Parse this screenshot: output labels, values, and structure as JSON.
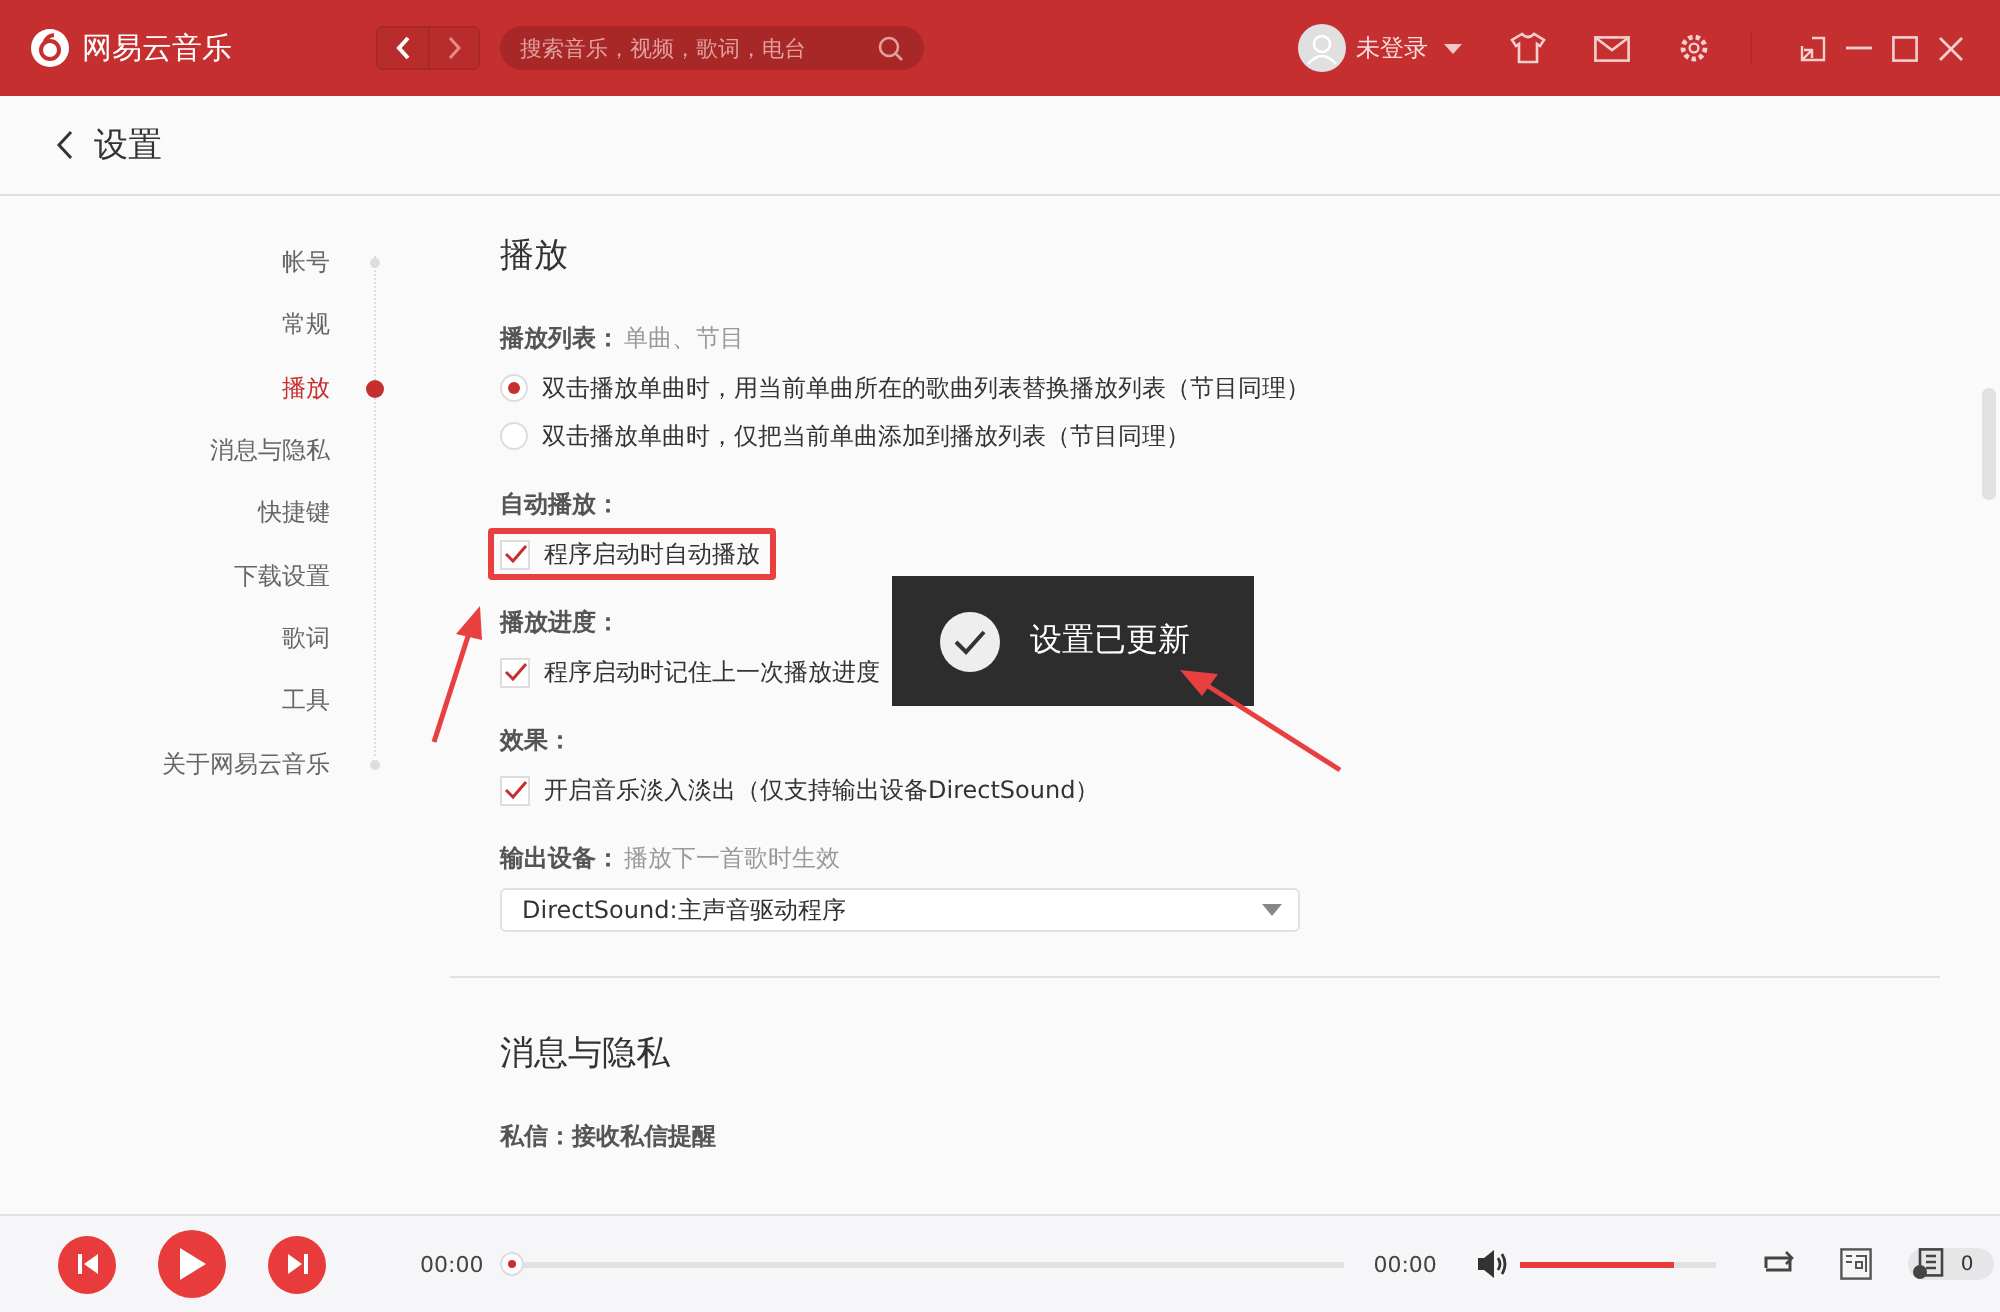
{
  "top_bar": {
    "app_name": "网易云音乐",
    "search": {
      "placeholder": "搜索音乐，视频，歌词，电台"
    },
    "user": "未登录"
  },
  "header": {
    "title": "设置"
  },
  "sidebar": {
    "items": [
      {
        "label": "帐号",
        "selected": false
      },
      {
        "label": "常规",
        "selected": false
      },
      {
        "label": "播放",
        "selected": true
      },
      {
        "label": "消息与隐私",
        "selected": false
      },
      {
        "label": "快捷键",
        "selected": false
      },
      {
        "label": "下载设置",
        "selected": false
      },
      {
        "label": "歌词",
        "selected": false
      },
      {
        "label": "工具",
        "selected": false
      },
      {
        "label": "关于网易云音乐",
        "selected": false
      }
    ]
  },
  "sections": [
    {
      "title": "播放",
      "groups": [
        {
          "label": "播放列表：",
          "hint": "单曲、节目",
          "kind": "radio",
          "options": [
            {
              "text": "双击播放单曲时，用当前单曲所在的歌曲列表替换播放列表（节目同理）",
              "selected": true
            },
            {
              "text": "双击播放单曲时，仅把当前单曲添加到播放列表（节目同理）",
              "selected": false
            }
          ]
        },
        {
          "label": "自动播放：",
          "kind": "checkbox",
          "options": [
            {
              "text": "程序启动时自动播放",
              "checked": true,
              "highlighted": true
            }
          ]
        },
        {
          "label": "播放进度：",
          "kind": "checkbox",
          "options": [
            {
              "text": "程序启动时记住上一次播放进度",
              "checked": true
            }
          ]
        },
        {
          "label": "效果：",
          "kind": "checkbox",
          "options": [
            {
              "text": "开启音乐淡入淡出（仅支持输出设备DirectSound）",
              "checked": true
            }
          ]
        },
        {
          "label": "输出设备：",
          "hint": "播放下一首歌时生效",
          "kind": "select",
          "value": "DirectSound:主声音驱动程序"
        }
      ]
    },
    {
      "title": "消息与隐私",
      "groups": [
        {
          "label": "私信：接收私信提醒",
          "kind": "none"
        }
      ]
    }
  ],
  "toast": {
    "text": "设置已更新"
  },
  "player": {
    "elapsed": "00:00",
    "duration": "00:00",
    "progress": {
      "level": 0
    },
    "volume": {
      "level": 0.78
    },
    "playlist_count": "0"
  }
}
